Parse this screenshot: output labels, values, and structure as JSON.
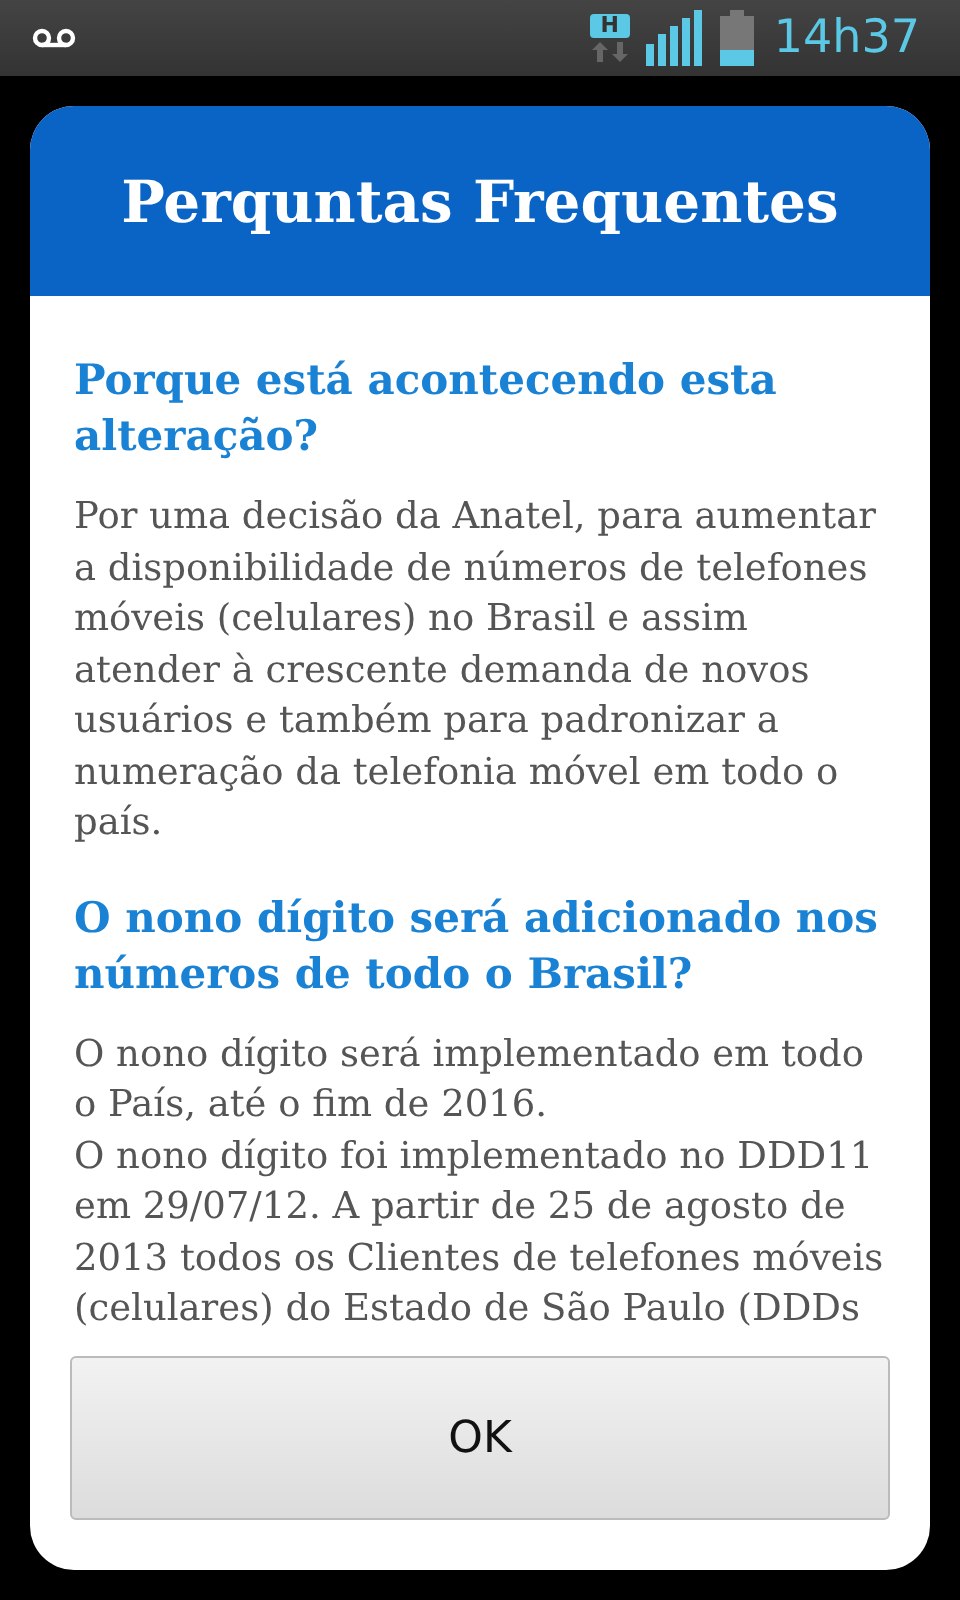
{
  "status_bar": {
    "time": "14h37",
    "network_type": "H"
  },
  "dialog": {
    "title": "Perquntas Frequentes",
    "sections": [
      {
        "question": "Porque está acontecendo esta alteração?",
        "answer": [
          "Por uma decisão da Anatel, para aumentar a disponibilidade de números de telefones móveis (celulares) no Brasil e assim atender à crescente demanda de novos usuários e também para padronizar a numeração da telefonia móvel em todo o país."
        ]
      },
      {
        "question": "O nono dígito será adicionado nos números de todo o Brasil?",
        "answer": [
          "O nono dígito será implementado em todo o País, até o fim de 2016.",
          "O nono dígito foi implementado no DDD11 em 29/07/12. A partir de 25 de agosto de 2013 todos os Clientes de telefones móveis (celulares) do Estado de São Paulo (DDDs"
        ]
      }
    ],
    "button": "OK"
  }
}
